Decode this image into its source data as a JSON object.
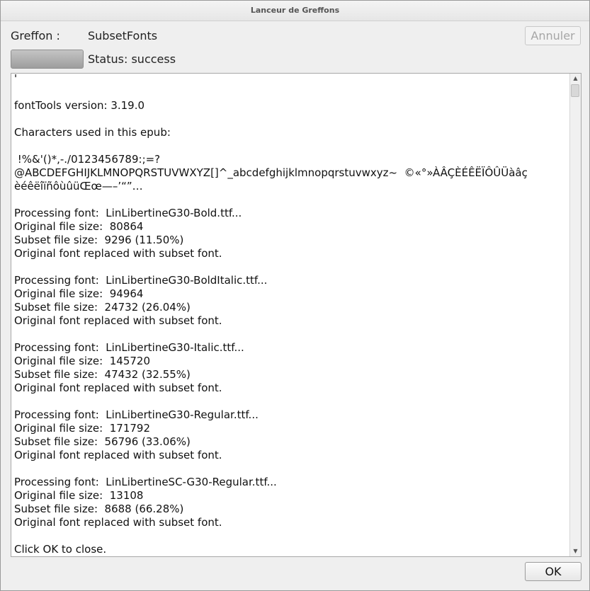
{
  "window": {
    "title": "Lanceur de Greffons"
  },
  "plugin": {
    "label": "Greffon :",
    "name": "SubsetFonts"
  },
  "buttons": {
    "cancel": "Annuler",
    "ok": "OK"
  },
  "progress": {
    "value": 1.0
  },
  "status": {
    "text": "Status: success"
  },
  "log": {
    "lines": [
      "'",
      "",
      "fontTools version: 3.19.0",
      "",
      "Characters used in this epub:",
      "",
      " !%&'()*,-./0123456789:;=?",
      "@ABCDEFGHIJKLMNOPQRSTUVWXYZ[]^_abcdefghijklmnopqrstuvwxyz~  ©«°»ÀÂÇÈÉÊËÏÔÛÜàâç",
      "èéêëîïñôùûüŒœ—–’“”…",
      "",
      "Processing font:  LinLibertineG30-Bold.ttf...",
      "Original file size:  80864",
      "Subset file size:  9296 (11.50%)",
      "Original font replaced with subset font.",
      "",
      "Processing font:  LinLibertineG30-BoldItalic.ttf...",
      "Original file size:  94964",
      "Subset file size:  24732 (26.04%)",
      "Original font replaced with subset font.",
      "",
      "Processing font:  LinLibertineG30-Italic.ttf...",
      "Original file size:  145720",
      "Subset file size:  47432 (32.55%)",
      "Original font replaced with subset font.",
      "",
      "Processing font:  LinLibertineG30-Regular.ttf...",
      "Original file size:  171792",
      "Subset file size:  56796 (33.06%)",
      "Original font replaced with subset font.",
      "",
      "Processing font:  LinLibertineSC-G30-Regular.ttf...",
      "Original file size:  13108",
      "Subset file size:  8688 (66.28%)",
      "Original font replaced with subset font.",
      "",
      "Click OK to close."
    ]
  },
  "scrollbar": {
    "up_icon": "chevron-up-icon",
    "down_icon": "chevron-down-icon"
  }
}
